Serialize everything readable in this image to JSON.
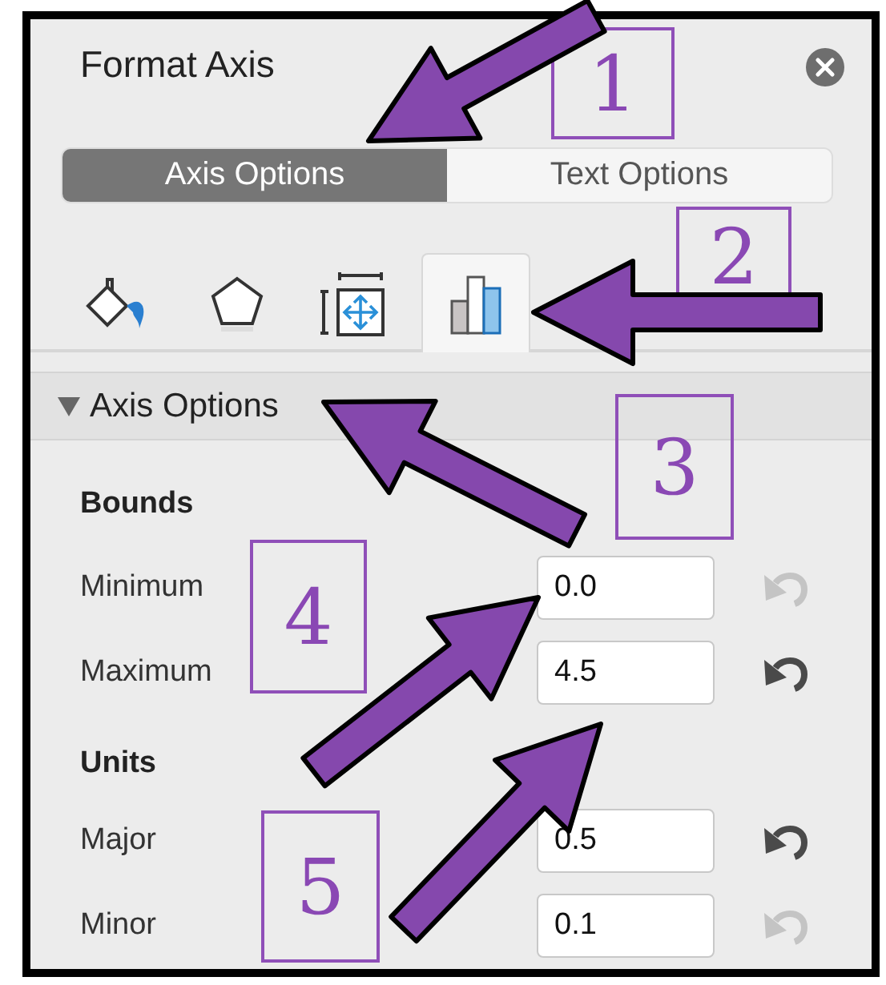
{
  "pane": {
    "title": "Format Axis"
  },
  "option_tabs": [
    {
      "label": "Axis Options",
      "selected": true
    },
    {
      "label": "Text Options",
      "selected": false
    }
  ],
  "icon_tabs": [
    {
      "kind": "fill",
      "selected": false
    },
    {
      "kind": "effects",
      "selected": false
    },
    {
      "kind": "size",
      "selected": false
    },
    {
      "kind": "axis",
      "selected": true
    }
  ],
  "section": {
    "title": "Axis Options",
    "expanded": true
  },
  "groups": [
    {
      "heading": "Bounds",
      "fields": [
        {
          "label": "Minimum",
          "value": "0.0",
          "reset_enabled": false
        },
        {
          "label": "Maximum",
          "value": "4.5",
          "reset_enabled": true
        }
      ]
    },
    {
      "heading": "Units",
      "fields": [
        {
          "label": "Major",
          "value": "0.5",
          "reset_enabled": true
        },
        {
          "label": "Minor",
          "value": "0.1",
          "reset_enabled": false
        }
      ]
    }
  ],
  "annotations": [
    {
      "number": "1"
    },
    {
      "number": "2"
    },
    {
      "number": "3"
    },
    {
      "number": "4"
    },
    {
      "number": "5"
    }
  ]
}
